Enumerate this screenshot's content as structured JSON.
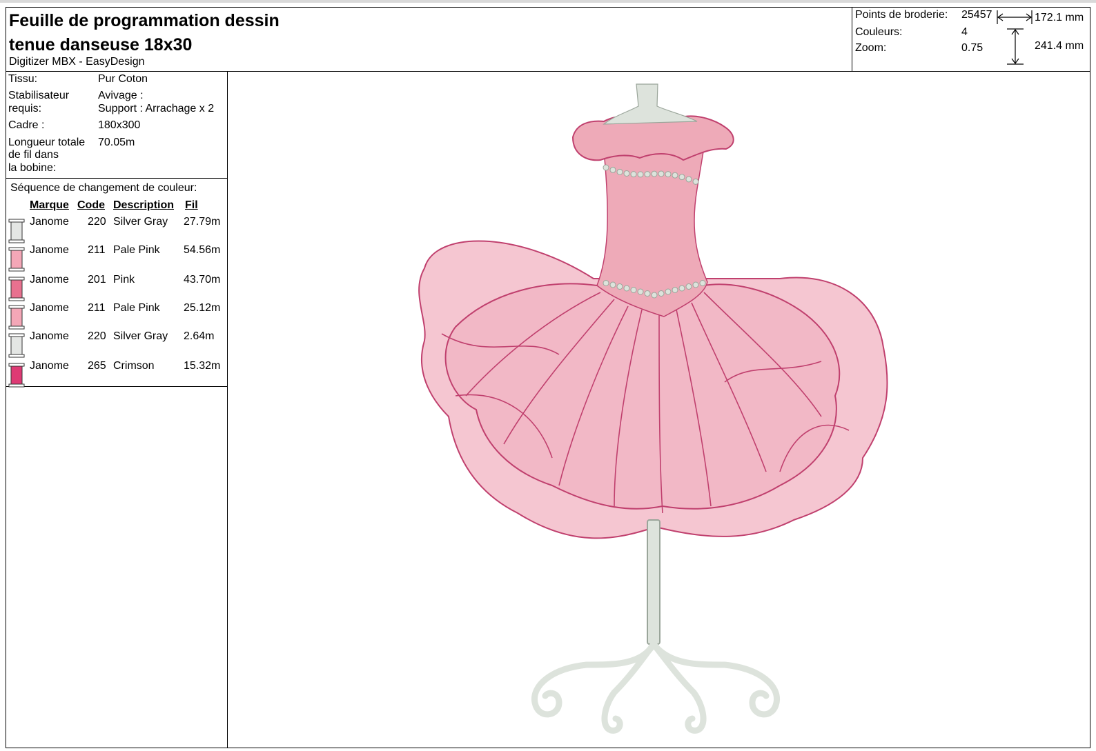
{
  "header": {
    "title_line1": "Feuille de programmation dessin",
    "title_line2": "tenue danseuse 18x30",
    "software": "Digitizer MBX - EasyDesign"
  },
  "stats": {
    "stitches_label": "Points de broderie:",
    "stitches_value": "25457",
    "colors_label": "Couleurs:",
    "colors_value": "4",
    "zoom_label": "Zoom:",
    "zoom_value": "0.75",
    "width": "172.1 mm",
    "height": "241.4 mm"
  },
  "info": {
    "fabric_label": "Tissu:",
    "fabric_value": "Pur Coton",
    "stabilizer_label_1": "Stabilisateur",
    "stabilizer_label_2": "requis:",
    "stabilizer_value_1": "Avivage :",
    "stabilizer_value_2": "Support : Arrachage x 2",
    "frame_label": "Cadre :",
    "frame_value": "180x300",
    "thread_label_1": "Longueur totale",
    "thread_label_2": "de fil dans",
    "thread_label_3": "la bobine:",
    "thread_value": "70.05m"
  },
  "sequence": {
    "title": "Séquence de changement de couleur:",
    "headers": {
      "brand": "Marque",
      "code": "Code",
      "description": "Description",
      "thread": "Fil"
    },
    "rows": [
      {
        "brand": "Janome",
        "code": "220",
        "description": "Silver Gray",
        "length": "27.79m",
        "color": "#e4e6e4"
      },
      {
        "brand": "Janome",
        "code": "211",
        "description": "Pale Pink",
        "length": "54.56m",
        "color": "#f4a7b7"
      },
      {
        "brand": "Janome",
        "code": "201",
        "description": "Pink",
        "length": "43.70m",
        "color": "#e8718f"
      },
      {
        "brand": "Janome",
        "code": "211",
        "description": "Pale Pink",
        "length": "25.12m",
        "color": "#f4a7b7"
      },
      {
        "brand": "Janome",
        "code": "220",
        "description": "Silver Gray",
        "length": "2.64m",
        "color": "#e4e6e4"
      },
      {
        "brand": "Janome",
        "code": "265",
        "description": "Crimson",
        "length": "15.32m",
        "color": "#de3a74"
      }
    ]
  },
  "design_colors": {
    "skirt_fill": "#f2b8c6",
    "skirt_line": "#c0406e",
    "bodice": "#eeaab8",
    "stand": "#dde3dc",
    "stand_line": "#9aa59a"
  }
}
